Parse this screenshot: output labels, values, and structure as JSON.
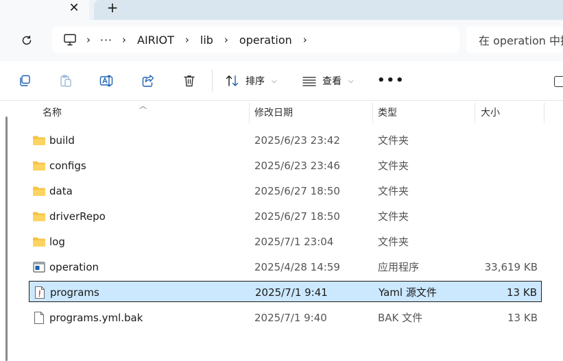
{
  "tab": {
    "close_glyph": "✕",
    "new_glyph": "+"
  },
  "address": {
    "more": "···",
    "separator": "›",
    "crumbs": [
      "AIRIOT",
      "lib",
      "operation"
    ],
    "search_placeholder": "在 operation 中搜索"
  },
  "toolbar": {
    "sort_label": "排序",
    "view_label": "查看",
    "more_glyph": "•••"
  },
  "columns": {
    "name": "名称",
    "date": "修改日期",
    "type": "类型",
    "size": "大小"
  },
  "files": [
    {
      "name": "build",
      "date": "2025/6/23 23:42",
      "type": "文件夹",
      "size": "",
      "icon": "folder-icon"
    },
    {
      "name": "configs",
      "date": "2025/6/23 23:46",
      "type": "文件夹",
      "size": "",
      "icon": "folder-icon"
    },
    {
      "name": "data",
      "date": "2025/6/27 18:50",
      "type": "文件夹",
      "size": "",
      "icon": "folder-icon"
    },
    {
      "name": "driverRepo",
      "date": "2025/6/27 18:50",
      "type": "文件夹",
      "size": "",
      "icon": "folder-icon"
    },
    {
      "name": "log",
      "date": "2025/7/1 23:04",
      "type": "文件夹",
      "size": "",
      "icon": "folder-icon"
    },
    {
      "name": "operation",
      "date": "2025/4/28 14:59",
      "type": "应用程序",
      "size": "33,619 KB",
      "icon": "application-icon"
    },
    {
      "name": "programs",
      "date": "2025/7/1 9:41",
      "type": "Yaml 源文件",
      "size": "13 KB",
      "icon": "yaml-file-icon",
      "selected": true
    },
    {
      "name": "programs.yml.bak",
      "date": "2025/7/1 9:40",
      "type": "BAK 文件",
      "size": "13 KB",
      "icon": "blank-file-icon"
    }
  ],
  "colors": {
    "selection": "#cce8ff",
    "folder": "#f6c445",
    "accent": "#1a5fb4"
  }
}
